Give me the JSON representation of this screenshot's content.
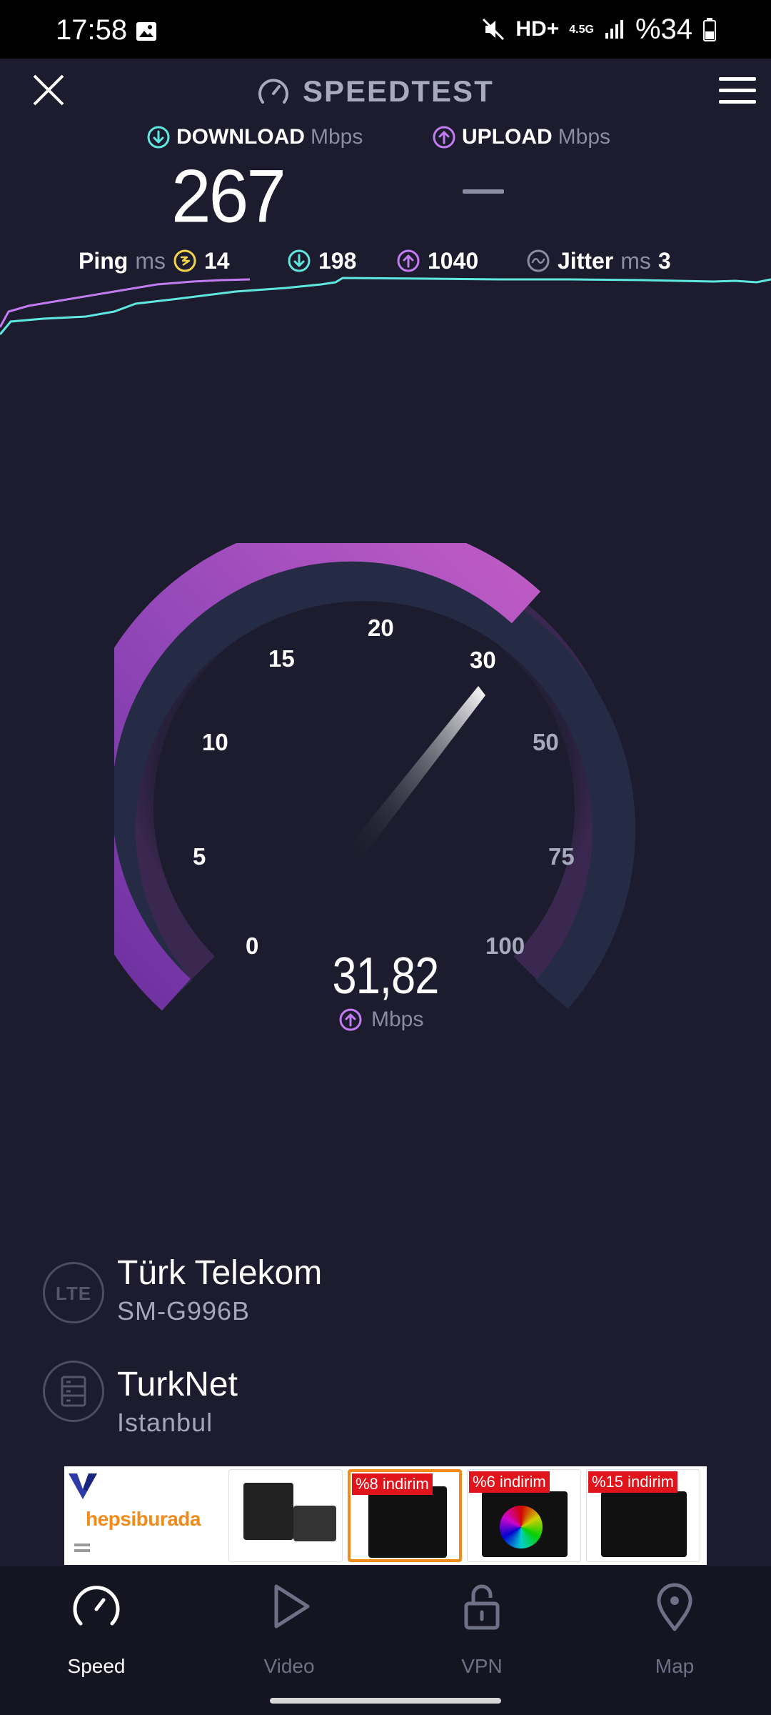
{
  "status_bar": {
    "time": "17:58",
    "hd_label": "HD+",
    "network": "4.5G",
    "battery": "%34"
  },
  "header": {
    "title": "SPEEDTEST",
    "icons": [
      "close-icon",
      "speedometer-icon",
      "menu-icon"
    ]
  },
  "download": {
    "label": "DOWNLOAD",
    "unit": "Mbps",
    "value": "267"
  },
  "upload": {
    "label": "UPLOAD",
    "unit": "Mbps",
    "value": "—"
  },
  "ping": {
    "label": "Ping",
    "unit": "ms",
    "idle": "14",
    "download": "198",
    "upload": "1040",
    "jitter_label": "Jitter",
    "jitter_unit": "ms",
    "jitter": "3"
  },
  "gauge": {
    "ticks": [
      "0",
      "5",
      "10",
      "15",
      "20",
      "30",
      "50",
      "75",
      "100"
    ],
    "value": "31,82",
    "unit": "Mbps",
    "colors": {
      "arc": "#a34fc0",
      "track": "#262b45",
      "accent_download": "#5fe8e0",
      "accent_upload": "#c07cf0"
    }
  },
  "provider": {
    "carrier_icon": "LTE",
    "carrier": "Türk Telekom",
    "device": "SM-G996B",
    "server": "TurkNet",
    "location": "Istanbul"
  },
  "ad": {
    "brand": "hepsiburada",
    "products": [
      {
        "badge": ""
      },
      {
        "badge": "%8 indirim"
      },
      {
        "badge": "%6 indirim"
      },
      {
        "badge": "%15 indirim"
      }
    ]
  },
  "nav": {
    "speed": "Speed",
    "video": "Video",
    "vpn": "VPN",
    "map": "Map"
  }
}
